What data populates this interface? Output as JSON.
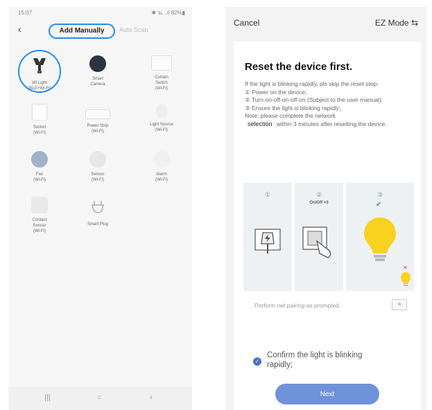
{
  "left": {
    "status_time": "15:07",
    "status_icons": "✱ ℡ .ıl 82%▮",
    "back": "‹",
    "tab_add": "Add Manually",
    "tab_scan": "Auto Scan",
    "devices": [
      {
        "label": "Wi Light\n(BLE+Wi-Fi)"
      },
      {
        "label": "Smart\nCamera"
      },
      {
        "label": "Curtain\nSwitch\n(Wi-Fi)"
      },
      {
        "label": "Socket\n(Wi-Fi)"
      },
      {
        "label": "Power Strip\n(Wi-Fi)"
      },
      {
        "label": "Light Source\n(Wi-Fi)"
      },
      {
        "label": "Fan\n(Wi-Fi)"
      },
      {
        "label": "Sensor\n(Wi-Fi)"
      },
      {
        "label": "Alarm\n(Wi-Fi)"
      },
      {
        "label": "Contact\nSensor\n(Wi-Fi)"
      },
      {
        "label": "Smart Plug"
      }
    ],
    "nav": [
      "|||",
      "○",
      "‹"
    ]
  },
  "right": {
    "cancel": "Cancel",
    "mode": "EZ Mode ⇆",
    "title": "Reset the device first.",
    "intro": "If the light is blinking rapidly, pls skip the reset step:",
    "steps": [
      "① Power on the device;",
      "② Turn on-off-on-off-on (Subject to the user manual);",
      "③ Ensure the light is blinking rapidly;"
    ],
    "note_1": "Note: please complete the network",
    "note_selection": "selection",
    "note_2": "within 3 minutes after resetting the device.",
    "panel_1_num": "①",
    "panel_2_num": "②",
    "panel_2_sub": "On/Off ×3",
    "panel_3_num": "③",
    "prompt": "Perform net pairing as prompted.",
    "prompt_btn": "≣",
    "confirm": "Confirm the light is blinking rapidly;",
    "next": "Next"
  }
}
